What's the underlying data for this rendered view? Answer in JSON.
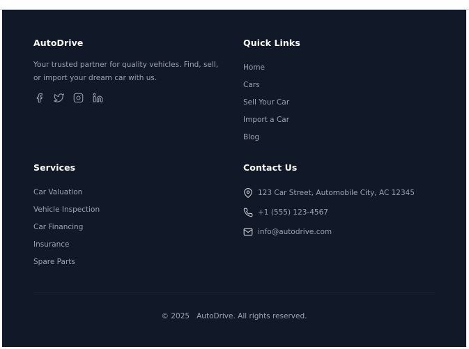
{
  "brand": {
    "name": "AutoDrive",
    "description": "Your trusted partner for quality vehicles. Find, sell, or import your dream car with us.",
    "socials": [
      "facebook-icon",
      "twitter-icon",
      "instagram-icon",
      "linkedin-icon"
    ]
  },
  "quick_links": {
    "title": "Quick Links",
    "items": [
      "Home",
      "Cars",
      "Sell Your Car",
      "Import a Car",
      "Blog"
    ]
  },
  "services": {
    "title": "Services",
    "items": [
      "Car Valuation",
      "Vehicle Inspection",
      "Car Financing",
      "Insurance",
      "Spare Parts"
    ]
  },
  "contact": {
    "title": "Contact Us",
    "address": "123 Car Street, Automobile City, AC 12345",
    "phone": "+1 (555) 123-4567",
    "email": "info@autodrive.com"
  },
  "footer": {
    "year": "© 2025",
    "rights": "AutoDrive. All rights reserved."
  },
  "colors": {
    "background": "#111827",
    "heading": "#f9fafb",
    "text": "#9ca3af"
  }
}
